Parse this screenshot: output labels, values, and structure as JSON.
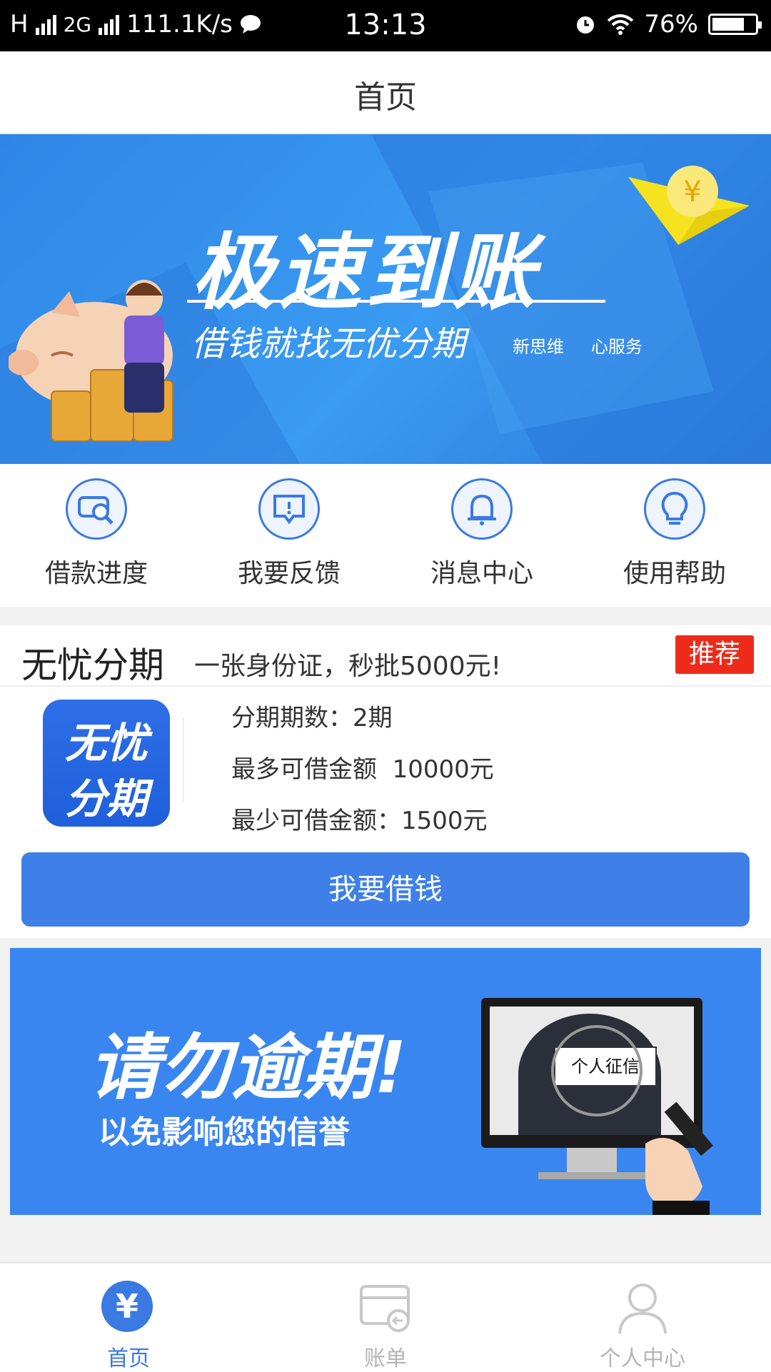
{
  "status_bar": {
    "network_1": "H",
    "network_2": "2G",
    "speed": "111.1K/s",
    "time": "13:13",
    "battery": "76%",
    "battery_level": 0.76
  },
  "header": {
    "title": "首页"
  },
  "hero_banner": {
    "title": "极速到账",
    "subtitle": "借钱就找无优分期",
    "tag_1": "新思维",
    "tag_2": "心服务"
  },
  "quick_menu": [
    {
      "label": "借款进度",
      "icon": "search-doc-icon"
    },
    {
      "label": "我要反馈",
      "icon": "feedback-icon"
    },
    {
      "label": "消息中心",
      "icon": "bell-icon"
    },
    {
      "label": "使用帮助",
      "icon": "lightbulb-icon"
    }
  ],
  "product": {
    "name": "无忧分期",
    "slogan": "一张身份证，秒批5000元!",
    "badge": "推荐",
    "logo_line_1": "无忧",
    "logo_line_2": "分期",
    "installments": "分期期数：2期",
    "max_amount": "最多可借金额  10000元",
    "min_amount": "最少可借金额：1500元",
    "cta": "我要借钱"
  },
  "notice_banner": {
    "title": "请勿逾期!",
    "subtitle": "以免影响您的信誉",
    "card_text": "个人征信"
  },
  "tab_bar": [
    {
      "label": "首页",
      "icon": "yen-icon",
      "active": true
    },
    {
      "label": "账单",
      "icon": "bill-icon",
      "active": false
    },
    {
      "label": "个人中心",
      "icon": "user-icon",
      "active": false
    }
  ],
  "colors": {
    "accent": "#3b79e3",
    "badge": "#ee2b1a",
    "banner": "#2f86e6"
  }
}
